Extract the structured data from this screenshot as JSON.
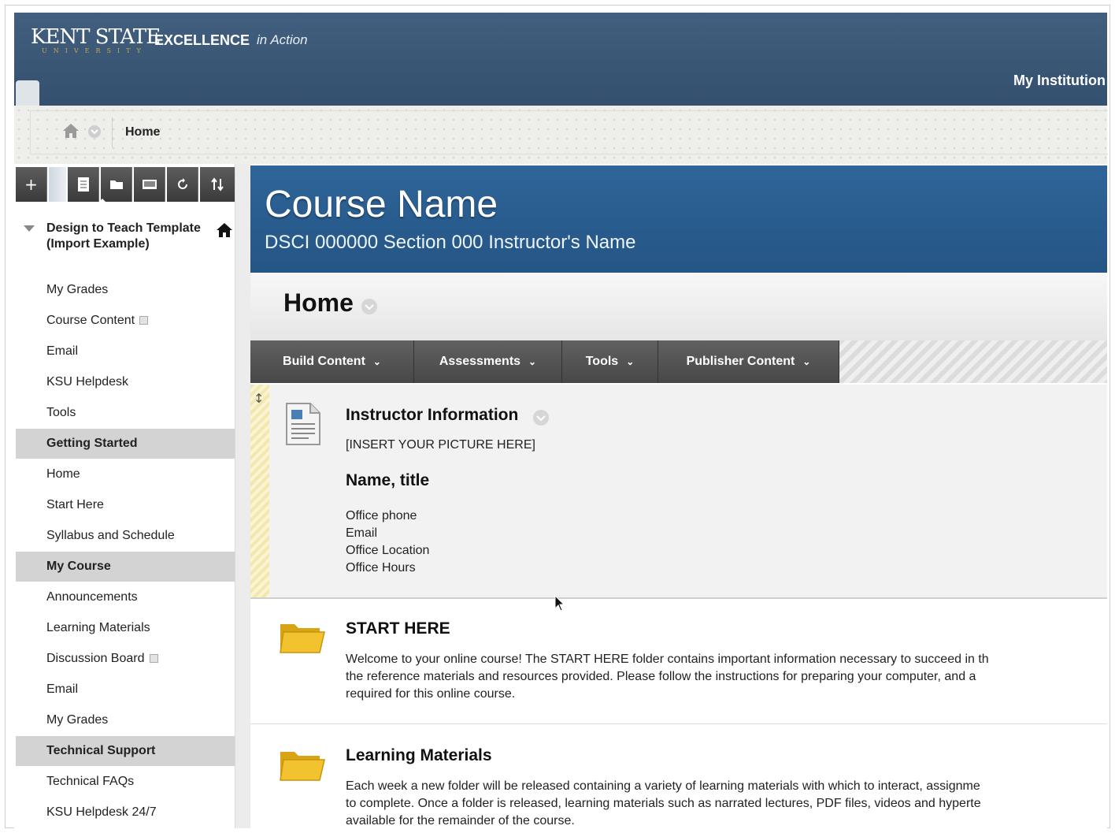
{
  "header": {
    "logo_main": "KENT STATE",
    "logo_sub": "UNIVERSITY",
    "tagline_bold": "EXCELLENCE",
    "tagline_italic": "in Action",
    "my_institution": "My Institution"
  },
  "breadcrumb": {
    "current": "Home"
  },
  "sidebar": {
    "toolbar": [
      "+",
      "▤",
      "▬",
      "▭",
      "↻",
      "⇅"
    ],
    "course_title": "Design to Teach Template (Import Example)",
    "items": [
      {
        "label": "My Grades",
        "type": "link"
      },
      {
        "label": "Course Content",
        "type": "link"
      },
      {
        "label": "Email",
        "type": "link"
      },
      {
        "label": "KSU Helpdesk",
        "type": "link"
      },
      {
        "label": "Tools",
        "type": "link"
      },
      {
        "label": "Getting Started",
        "type": "header"
      },
      {
        "label": "Home",
        "type": "link"
      },
      {
        "label": "Start Here",
        "type": "link"
      },
      {
        "label": "Syllabus and Schedule",
        "type": "link"
      },
      {
        "label": "My Course",
        "type": "header"
      },
      {
        "label": "Announcements",
        "type": "link"
      },
      {
        "label": "Learning Materials",
        "type": "link"
      },
      {
        "label": "Discussion Board",
        "type": "link"
      },
      {
        "label": "Email",
        "type": "link"
      },
      {
        "label": "My Grades",
        "type": "link"
      },
      {
        "label": "Technical Support",
        "type": "header"
      },
      {
        "label": "Technical FAQs",
        "type": "link"
      },
      {
        "label": "KSU Helpdesk 24/7",
        "type": "link"
      }
    ]
  },
  "banner": {
    "title": "Course Name",
    "subtitle": "DSCI 000000 Section 000 Instructor's Name"
  },
  "page": {
    "title": "Home"
  },
  "actions": [
    "Build Content",
    "Assessments",
    "Tools",
    "Publisher Content"
  ],
  "items": {
    "instructor": {
      "title": "Instructor Information",
      "picture": "[INSERT YOUR PICTURE HERE]",
      "name_title": "Name, title",
      "lines": [
        "Office phone",
        "Email",
        "Office Location",
        "Office Hours"
      ]
    },
    "start_here": {
      "title": "START HERE",
      "lines": [
        "Welcome to your online course! The START HERE folder contains important information necessary to succeed in th",
        "the reference materials and resources provided. Please follow the instructions for preparing your computer, and a",
        "required for this online course."
      ]
    },
    "learning": {
      "title": "Learning Materials",
      "lines": [
        "Each week a new folder will be released containing a variety of learning materials with which to interact, assignme",
        "to complete. Once a folder is released, learning materials such as narrated lectures, PDF files, videos and hyperte",
        "available for the remainder of the course."
      ]
    }
  },
  "colors": {
    "header_bg": "#3b5878",
    "banner_bg": "#2a5d90",
    "action_bar": "#525252",
    "menu_header": "#d3d3d3"
  }
}
